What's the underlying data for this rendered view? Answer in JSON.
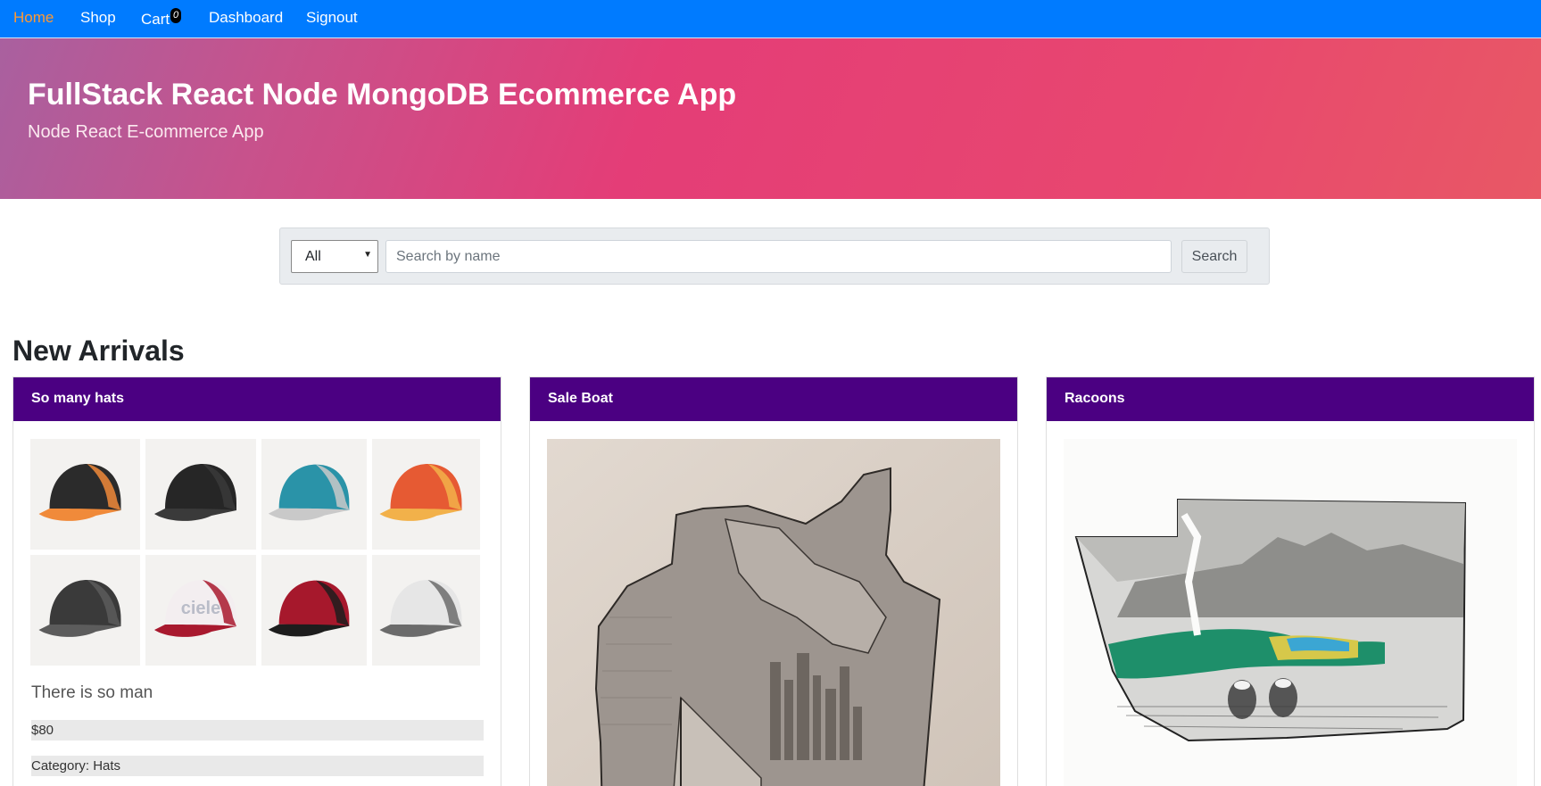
{
  "nav": {
    "items": [
      {
        "label": "Home",
        "active": true
      },
      {
        "label": "Shop",
        "active": false
      },
      {
        "label": "Cart",
        "active": false
      },
      {
        "label": "Dashboard",
        "active": false
      },
      {
        "label": "Signout",
        "active": false
      }
    ],
    "cart_count": "0"
  },
  "hero": {
    "title": "FullStack React Node MongoDB Ecommerce App",
    "subtitle": "Node React E-commerce App"
  },
  "search": {
    "category_value": "All",
    "placeholder": "Search by name",
    "button_label": "Search"
  },
  "section": {
    "title": "New Arrivals"
  },
  "products": [
    {
      "name": "So many hats",
      "description": "There is so man",
      "price": "$80",
      "category": "Category: Hats",
      "hat_colors": [
        {
          "crown": "#2b2b2b",
          "accent": "#f08a3a"
        },
        {
          "crown": "#262626",
          "accent": "#3a3a3a"
        },
        {
          "crown": "#2a93a8",
          "accent": "#c9c9c9"
        },
        {
          "crown": "#e65a33",
          "accent": "#f2b14a"
        },
        {
          "crown": "#3a3a3a",
          "accent": "#5c5c5c"
        },
        {
          "crown": "#f3eef0",
          "accent": "#a8192e"
        },
        {
          "crown": "#a6182c",
          "accent": "#1d1d1d"
        },
        {
          "crown": "#e6e6e6",
          "accent": "#6b6b6b"
        }
      ],
      "hat_brand_text": "ciele"
    },
    {
      "name": "Sale Boat"
    },
    {
      "name": "Racoons"
    }
  ],
  "colors": {
    "navbar": "#007bff",
    "nav_active": "#ff9933",
    "card_header": "#4b0082"
  }
}
